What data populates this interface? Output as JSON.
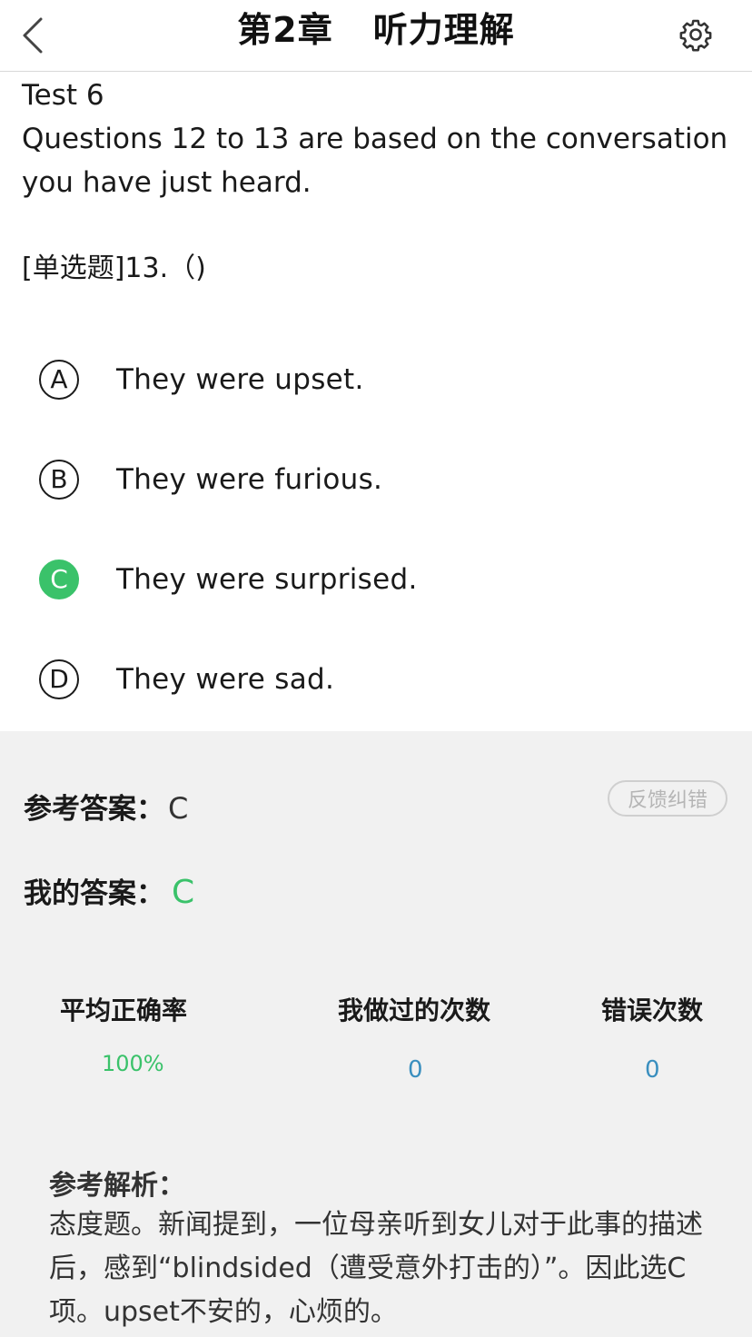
{
  "header": {
    "chapter": "第2章",
    "section": "听力理解",
    "back_icon": "chevron-left-icon",
    "settings_icon": "gear-icon"
  },
  "question": {
    "test_label": "Test 6",
    "intro": "Questions 12 to 13 are based on the conversation you have just heard.",
    "type_and_number": "[单选题]13.（)",
    "options": [
      {
        "letter": "A",
        "text": "They were upset.",
        "selected": false
      },
      {
        "letter": "B",
        "text": "They were furious.",
        "selected": false
      },
      {
        "letter": "C",
        "text": "They were surprised.",
        "selected": true
      },
      {
        "letter": "D",
        "text": "They were sad.",
        "selected": false
      }
    ]
  },
  "answer": {
    "reference_label": "参考答案：",
    "reference_value": "C",
    "mine_label": "我的答案：",
    "mine_value": "C",
    "feedback_label": "反馈纠错"
  },
  "stats": {
    "accuracy_label": "平均正确率",
    "accuracy_value": "100%",
    "done_label": "我做过的次数",
    "done_value": "0",
    "wrong_label": "错误次数",
    "wrong_value": "0"
  },
  "analysis": {
    "title": "参考解析：",
    "text": "态度题。新闻提到，一位母亲听到女儿对于此事的描述后，感到“blindsided（遭受意外打击的）”。因此选C项。upset不安的，心烦的。"
  },
  "colors": {
    "accent_green": "#3ac26a",
    "stat_blue": "#3a8fbf",
    "panel_bg": "#f1f1f1"
  }
}
